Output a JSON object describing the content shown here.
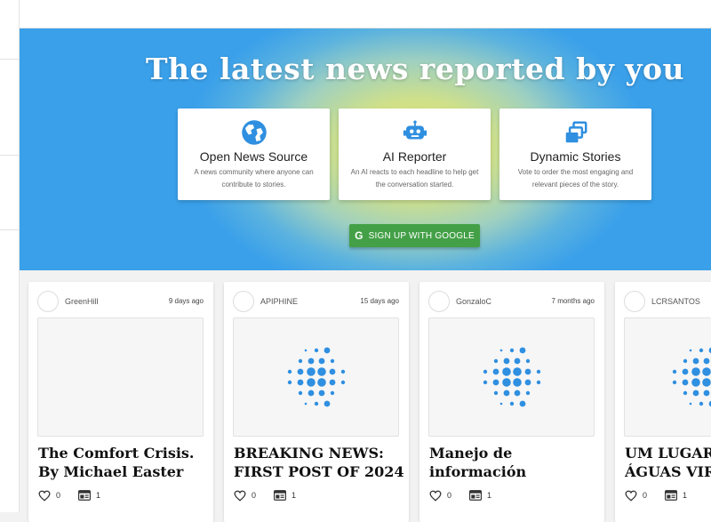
{
  "hero": {
    "title": "The latest news reported by you",
    "features": [
      {
        "icon": "globe-icon",
        "title": "Open News Source",
        "desc": "A news community where anyone can contribute to stories."
      },
      {
        "icon": "robot-icon",
        "title": "AI Reporter",
        "desc": "An AI reacts to each headline to help get the conversation started."
      },
      {
        "icon": "stacked-windows-icon",
        "title": "Dynamic Stories",
        "desc": "Vote to order the most engaging and relevant pieces of the story."
      }
    ],
    "signup_label": "SIGN UP WITH GOOGLE"
  },
  "colors": {
    "accent_blue": "#2f8fe0",
    "google_green": "#43a047"
  },
  "posts": [
    {
      "author": "GreenHill",
      "time": "9 days ago",
      "title": "The Comfort Crisis. By Michael Easter",
      "likes": "0",
      "comments": "1",
      "has_thumb_icon": false
    },
    {
      "author": "APIPHINE",
      "time": "15 days ago",
      "title": "BREAKING NEWS: FIRST POST OF 2024",
      "likes": "0",
      "comments": "1",
      "has_thumb_icon": true
    },
    {
      "author": "GonzaloC",
      "time": "7 months ago",
      "title": "Manejo de información",
      "likes": "0",
      "comments": "1",
      "has_thumb_icon": true
    },
    {
      "author": "LCRSANTOS",
      "time": "",
      "title": "UM LUGAR C ÁGUAS VIRT",
      "likes": "0",
      "comments": "1",
      "has_thumb_icon": true
    }
  ]
}
